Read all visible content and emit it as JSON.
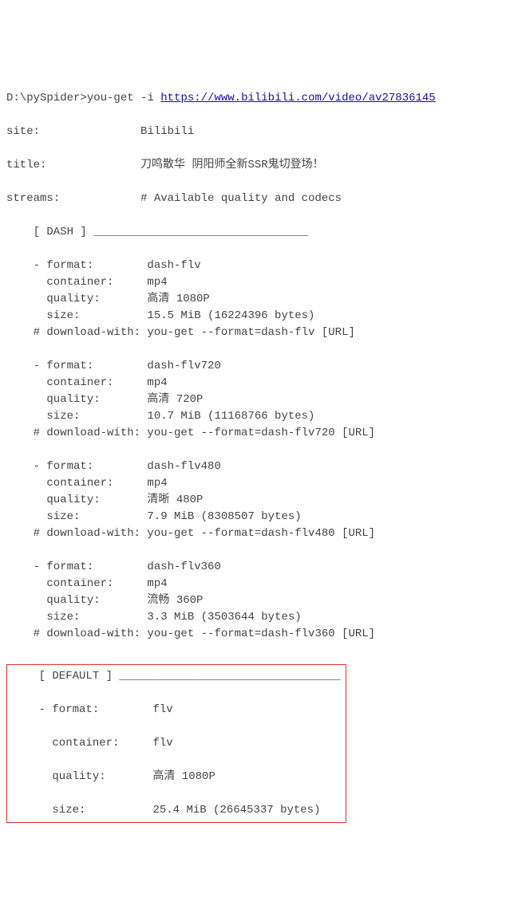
{
  "prompt": "D:\\pySpider>",
  "command": "you-get -i ",
  "url": "https://www.bilibili.com/video/av27836145",
  "site_label": "site:",
  "site_value": "Bilibili",
  "title_label": "title:",
  "title_value": "刀鸣散华 阴阳师全新SSR鬼切登场！",
  "streams_label": "streams:",
  "streams_value": "# Available quality and codecs",
  "dash_header": "    [ DASH ] ________________________________",
  "dash_streams": [
    {
      "format": "dash-flv",
      "container": "mp4",
      "quality": "高清 1080P",
      "size": "15.5 MiB (16224396 bytes)",
      "download_with": "you-get --format=dash-flv [URL]"
    },
    {
      "format": "dash-flv720",
      "container": "mp4",
      "quality": "高清 720P",
      "size": "10.7 MiB (11168766 bytes)",
      "download_with": "you-get --format=dash-flv720 [URL]"
    },
    {
      "format": "dash-flv480",
      "container": "mp4",
      "quality": "清晰 480P",
      "size": "7.9 MiB (8308507 bytes)",
      "download_with": "you-get --format=dash-flv480 [URL]"
    },
    {
      "format": "dash-flv360",
      "container": "mp4",
      "quality": "流畅 360P",
      "size": "3.3 MiB (3503644 bytes)",
      "download_with": "you-get --format=dash-flv360 [URL]"
    }
  ],
  "default_header": "    [ DEFAULT ] _________________________________",
  "default_stream": {
    "format": "flv",
    "container": "flv",
    "quality": "高清 1080P",
    "size": "25.4 MiB (26645337 bytes)"
  },
  "field_labels": {
    "format": "    - format:        ",
    "container": "      container:     ",
    "quality": "      quality:       ",
    "size": "      size:          ",
    "download_with": "    # download-with: "
  }
}
